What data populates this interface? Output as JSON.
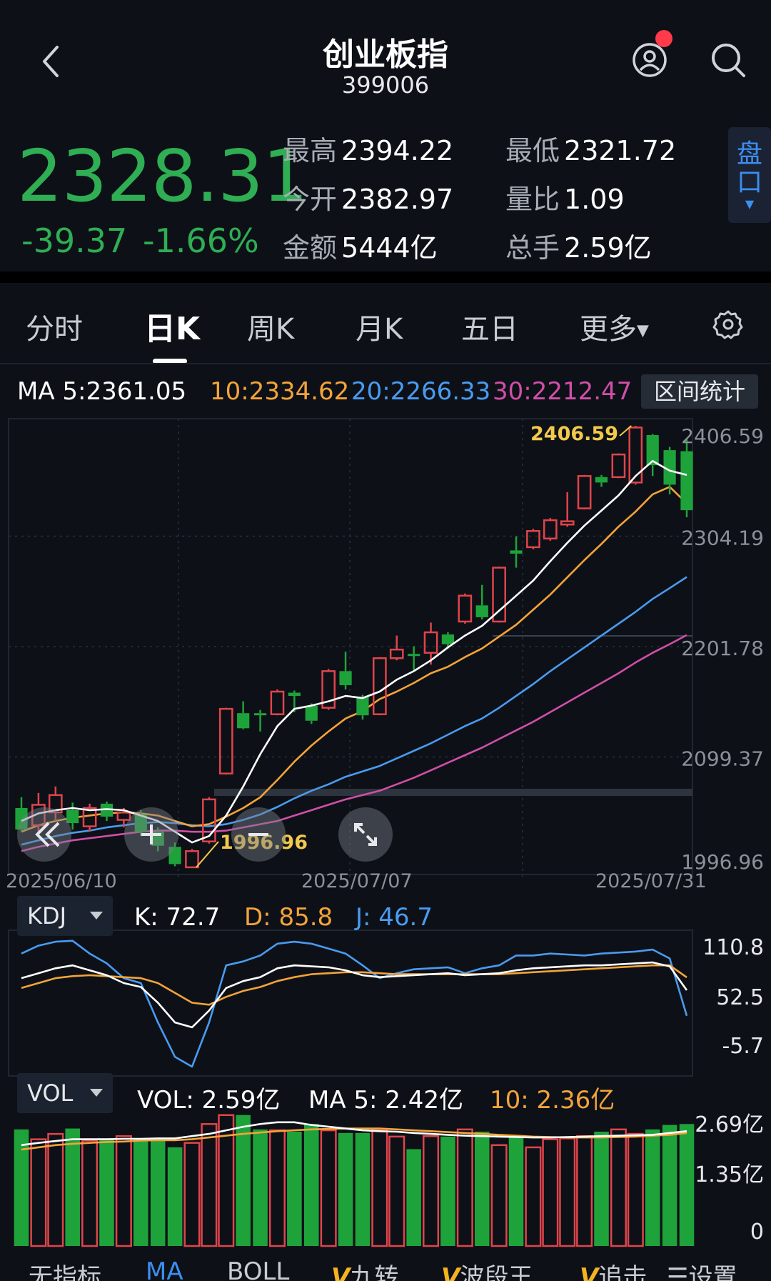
{
  "header": {
    "title": "创业板指",
    "code": "399006"
  },
  "quote": {
    "price": "2328.31",
    "change": "-39.37",
    "change_pct": "-1.66%",
    "stats": [
      {
        "label": "最高",
        "value": "2394.22"
      },
      {
        "label": "最低",
        "value": "2321.72"
      },
      {
        "label": "今开",
        "value": "2382.97"
      },
      {
        "label": "量比",
        "value": "1.09"
      },
      {
        "label": "金额",
        "value": "5444亿"
      },
      {
        "label": "总手",
        "value": "2.59亿"
      }
    ],
    "pankou_label": [
      "盘",
      "口"
    ]
  },
  "tabs": [
    "分时",
    "日K",
    "周K",
    "月K",
    "五日",
    "更多"
  ],
  "active_tab": "日K",
  "ma_legend": {
    "ma5": "MA 5:2361.05",
    "ma10": "10:2334.62",
    "ma20": "20:2266.33",
    "ma30": "30:2212.47",
    "range_button": "区间统计"
  },
  "colors": {
    "up": "#e0444b",
    "down": "#1ea33b",
    "ma5": "#ffffff",
    "ma10": "#f5a33a",
    "ma20": "#4a9bf0",
    "ma30": "#d14fa8",
    "highlight": "#f2c94c"
  },
  "chart_data": [
    {
      "type": "candlestick",
      "y_ticks": [
        "2406.59",
        "2304.19",
        "2201.78",
        "2099.37",
        "1996.96"
      ],
      "ylim": [
        1996.96,
        2406.59
      ],
      "x_labels": [
        "2025/06/10",
        "2025/07/07",
        "2025/07/31"
      ],
      "annotations": [
        "2406.59",
        "1996.96"
      ],
      "candles": [
        {
          "o": 2052,
          "h": 2062,
          "l": 2030,
          "c": 2032
        },
        {
          "o": 2036,
          "h": 2066,
          "l": 2030,
          "c": 2055
        },
        {
          "o": 2048,
          "h": 2072,
          "l": 2040,
          "c": 2064
        },
        {
          "o": 2050,
          "h": 2057,
          "l": 2032,
          "c": 2038
        },
        {
          "o": 2035,
          "h": 2056,
          "l": 2030,
          "c": 2052
        },
        {
          "o": 2056,
          "h": 2058,
          "l": 2040,
          "c": 2044
        },
        {
          "o": 2041,
          "h": 2052,
          "l": 2034,
          "c": 2048
        },
        {
          "o": 2046,
          "h": 2050,
          "l": 2026,
          "c": 2030
        },
        {
          "o": 2030,
          "h": 2034,
          "l": 2012,
          "c": 2017
        },
        {
          "o": 2016,
          "h": 2020,
          "l": 1998,
          "c": 2000
        },
        {
          "o": 1997,
          "h": 2014,
          "l": 1997,
          "c": 2012
        },
        {
          "o": 2021,
          "h": 2062,
          "l": 2019,
          "c": 2060
        },
        {
          "o": 2084,
          "h": 2145,
          "l": 2083,
          "c": 2144
        },
        {
          "o": 2140,
          "h": 2151,
          "l": 2125,
          "c": 2126
        },
        {
          "o": 2140,
          "h": 2143,
          "l": 2123,
          "c": 2139
        },
        {
          "o": 2139,
          "h": 2162,
          "l": 2138,
          "c": 2160
        },
        {
          "o": 2159,
          "h": 2161,
          "l": 2141,
          "c": 2156
        },
        {
          "o": 2147,
          "h": 2149,
          "l": 2130,
          "c": 2133
        },
        {
          "o": 2145,
          "h": 2181,
          "l": 2143,
          "c": 2179
        },
        {
          "o": 2179,
          "h": 2197,
          "l": 2162,
          "c": 2166
        },
        {
          "o": 2155,
          "h": 2157,
          "l": 2134,
          "c": 2138
        },
        {
          "o": 2139,
          "h": 2192,
          "l": 2138,
          "c": 2191
        },
        {
          "o": 2191,
          "h": 2212,
          "l": 2189,
          "c": 2199
        },
        {
          "o": 2195,
          "h": 2202,
          "l": 2180,
          "c": 2194
        },
        {
          "o": 2196,
          "h": 2224,
          "l": 2185,
          "c": 2215
        },
        {
          "o": 2213,
          "h": 2215,
          "l": 2200,
          "c": 2204
        },
        {
          "o": 2225,
          "h": 2251,
          "l": 2223,
          "c": 2249
        },
        {
          "o": 2240,
          "h": 2259,
          "l": 2227,
          "c": 2229
        },
        {
          "o": 2225,
          "h": 2276,
          "l": 2224,
          "c": 2275
        },
        {
          "o": 2291,
          "h": 2304,
          "l": 2275,
          "c": 2288
        },
        {
          "o": 2294,
          "h": 2311,
          "l": 2292,
          "c": 2309
        },
        {
          "o": 2302,
          "h": 2321,
          "l": 2300,
          "c": 2319
        },
        {
          "o": 2315,
          "h": 2345,
          "l": 2313,
          "c": 2318
        },
        {
          "o": 2330,
          "h": 2361,
          "l": 2329,
          "c": 2360
        },
        {
          "o": 2359,
          "h": 2361,
          "l": 2350,
          "c": 2354
        },
        {
          "o": 2359,
          "h": 2381,
          "l": 2358,
          "c": 2380
        },
        {
          "o": 2354,
          "h": 2406.59,
          "l": 2352,
          "c": 2405
        },
        {
          "o": 2398,
          "h": 2399,
          "l": 2360,
          "c": 2370
        },
        {
          "o": 2384,
          "h": 2387,
          "l": 2343,
          "c": 2352
        },
        {
          "o": 2383,
          "h": 2394.22,
          "l": 2321.72,
          "c": 2328.31
        }
      ],
      "ma5": [
        2040,
        2047,
        2050,
        2052,
        2050,
        2051,
        2050,
        2045,
        2040,
        2030,
        2020,
        2026,
        2045,
        2072,
        2102,
        2128,
        2144,
        2147,
        2151,
        2156,
        2154,
        2160,
        2171,
        2179,
        2189,
        2201,
        2212,
        2221,
        2235,
        2249,
        2263,
        2281,
        2298,
        2314,
        2328,
        2342,
        2360,
        2374,
        2365,
        2361.05
      ],
      "ma10": [
        2030,
        2036,
        2040,
        2043,
        2045,
        2047,
        2048,
        2047,
        2045,
        2040,
        2035,
        2037,
        2044,
        2052,
        2062,
        2078,
        2095,
        2110,
        2123,
        2135,
        2142,
        2153,
        2160,
        2168,
        2177,
        2183,
        2192,
        2200,
        2211,
        2222,
        2236,
        2250,
        2266,
        2282,
        2297,
        2313,
        2327,
        2343,
        2350,
        2334.62
      ],
      "ma20": [
        2018,
        2022,
        2026,
        2029,
        2031,
        2034,
        2036,
        2038,
        2039,
        2038,
        2036,
        2035,
        2037,
        2041,
        2046,
        2053,
        2061,
        2068,
        2074,
        2081,
        2086,
        2091,
        2098,
        2105,
        2112,
        2120,
        2128,
        2135,
        2145,
        2156,
        2167,
        2179,
        2190,
        2201,
        2212,
        2223,
        2234,
        2246,
        2256,
        2266.33
      ],
      "ma30": [
        2012,
        2016,
        2019,
        2022,
        2024,
        2026,
        2028,
        2030,
        2031,
        2031,
        2030,
        2030,
        2031,
        2034,
        2037,
        2040,
        2045,
        2050,
        2055,
        2060,
        2064,
        2068,
        2074,
        2080,
        2087,
        2094,
        2101,
        2108,
        2116,
        2124,
        2132,
        2141,
        2150,
        2159,
        2168,
        2177,
        2187,
        2196,
        2204,
        2212.47
      ]
    },
    {
      "type": "line",
      "name": "KDJ",
      "y_ticks": [
        "110.8",
        "52.5",
        "-5.7"
      ],
      "ylim": [
        -5.7,
        125
      ],
      "K": [
        85,
        90,
        95,
        98,
        93,
        88,
        80,
        76,
        60,
        40,
        35,
        52,
        75,
        82,
        86,
        95,
        98,
        97,
        96,
        93,
        88,
        86,
        87,
        88,
        89,
        90,
        88,
        89,
        90,
        93,
        95,
        96,
        97,
        98,
        98,
        99,
        100,
        101,
        97,
        72.7
      ],
      "D": [
        75,
        80,
        85,
        87,
        88,
        87,
        86,
        85,
        80,
        70,
        60,
        58,
        66,
        72,
        76,
        82,
        86,
        89,
        90,
        91,
        91,
        90,
        89,
        89,
        89,
        89,
        89,
        89,
        89,
        90,
        91,
        92,
        93,
        94,
        95,
        96,
        97,
        98,
        98,
        85.8
      ],
      "J": [
        110,
        118,
        122,
        123,
        110,
        100,
        85,
        80,
        40,
        5,
        -5,
        40,
        98,
        102,
        108,
        120,
        122,
        120,
        115,
        110,
        98,
        85,
        90,
        94,
        95,
        96,
        90,
        95,
        98,
        108,
        108,
        110,
        109,
        108,
        110,
        111,
        112,
        114,
        105,
        46.7
      ]
    },
    {
      "type": "bar",
      "name": "VOL",
      "y_ticks": [
        "2.69亿",
        "1.35亿",
        "0"
      ],
      "ylim": [
        0,
        2.9
      ],
      "values": [
        2.6,
        2.38,
        2.5,
        2.62,
        2.35,
        2.4,
        2.45,
        2.4,
        2.35,
        2.2,
        2.3,
        2.72,
        2.92,
        2.92,
        2.6,
        2.58,
        2.55,
        2.72,
        2.58,
        2.52,
        2.52,
        2.6,
        2.44,
        2.16,
        2.45,
        2.44,
        2.6,
        2.55,
        2.25,
        2.42,
        2.2,
        2.38,
        2.4,
        2.45,
        2.55,
        2.6,
        2.5,
        2.6,
        2.7,
        2.72
      ],
      "ma5": [
        2.25,
        2.3,
        2.34,
        2.38,
        2.38,
        2.38,
        2.39,
        2.39,
        2.4,
        2.4,
        2.45,
        2.5,
        2.58,
        2.66,
        2.72,
        2.76,
        2.76,
        2.7,
        2.66,
        2.62,
        2.58,
        2.56,
        2.55,
        2.52,
        2.5,
        2.48,
        2.46,
        2.45,
        2.44,
        2.43,
        2.42,
        2.42,
        2.43,
        2.44,
        2.45,
        2.46,
        2.47,
        2.48,
        2.52,
        2.56
      ],
      "ma10": [
        2.15,
        2.2,
        2.25,
        2.28,
        2.3,
        2.32,
        2.33,
        2.35,
        2.36,
        2.36,
        2.38,
        2.42,
        2.46,
        2.5,
        2.53,
        2.56,
        2.58,
        2.6,
        2.61,
        2.62,
        2.62,
        2.62,
        2.6,
        2.58,
        2.56,
        2.54,
        2.52,
        2.5,
        2.48,
        2.46,
        2.44,
        2.43,
        2.42,
        2.42,
        2.42,
        2.43,
        2.44,
        2.46,
        2.48,
        2.52
      ]
    }
  ],
  "kdj_legend": {
    "selector": "KDJ",
    "k": "K: 72.7",
    "d": "D: 85.8",
    "j": "J: 46.7"
  },
  "vol_legend": {
    "selector": "VOL",
    "vol": "VOL: 2.59亿",
    "ma5": "MA 5: 2.42亿",
    "ma10": "10: 2.36亿"
  },
  "bottom_bar": {
    "items": [
      "无指标",
      "MA",
      "BOLL",
      "九转",
      "波段王",
      "追击",
      "设置"
    ],
    "v_prefix": "V"
  }
}
